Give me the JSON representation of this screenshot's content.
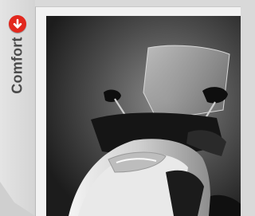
{
  "side_tab": {
    "label": "Comfort",
    "badge_icon": "arrow-down-circle-icon",
    "badge_color": "#e2281e"
  },
  "product_image": {
    "subject": "scooter-with-windscreen"
  }
}
